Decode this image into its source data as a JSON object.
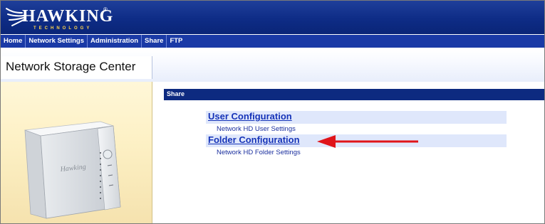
{
  "brand": {
    "name": "HAWKING",
    "tagline": "TECHNOLOGY",
    "reg_mark": "®"
  },
  "nav": {
    "items": [
      "Home",
      "Network Settings",
      "Administration",
      "Share",
      "FTP"
    ]
  },
  "page_title": "Network Storage Center",
  "section_title": "Share",
  "items": [
    {
      "label": "User Configuration",
      "description": "Network HD User Settings"
    },
    {
      "label": "Folder Configuration",
      "description": "Network HD Folder Settings"
    }
  ],
  "device": {
    "logo_text": "Hawking"
  },
  "colors": {
    "header": "#0e2c86",
    "nav": "#1a3aa6",
    "section_bar": "#0d2a80",
    "link": "#1533b8",
    "arrow": "#e0141a"
  }
}
